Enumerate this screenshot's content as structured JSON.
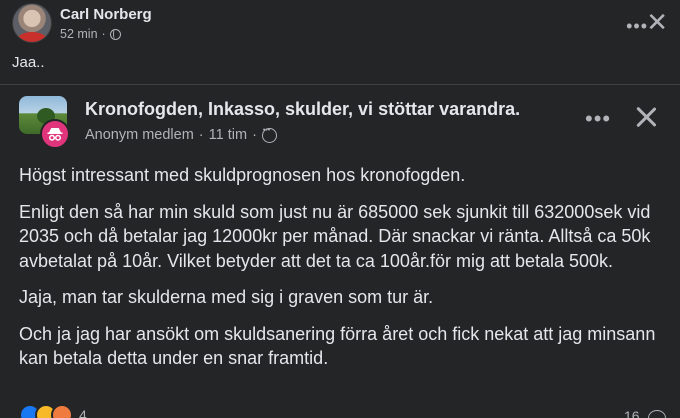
{
  "outer_post": {
    "author": "Carl Norberg",
    "time": "52 min",
    "privacy_icon": "globe-icon",
    "text": "Jaa.."
  },
  "shared_post": {
    "group_name": "Kronofogden, Inkasso, skulder, vi stöttar varandra.",
    "author": "Anonym medlem",
    "separator": "·",
    "time": "11 tim",
    "audience_icon": "group-icon",
    "paragraphs": [
      "Högst intressant med skuldprognosen hos kronofogden.",
      "Enligt den så har min skuld som just nu är 685000 sek sjunkit till 632000sek vid 2035 och då betalar jag 12000kr per månad. Där snackar vi ränta. Alltså ca 50k avbetalat på 10år. Vilket betyder att det ta ca 100år.för mig att betala 500k.",
      "Jaja, man tar skulderna med sig i graven som tur är.",
      "Och ja jag har ansökt om skuldsanering förra året och fick nekat att jag minsann kan betala detta under en snar framtid."
    ]
  },
  "footer": {
    "reaction_count": "4",
    "comment_count": "16"
  },
  "icons": {
    "more": "more-icon",
    "close": "close-icon",
    "anonymous": "anonymous-icon",
    "comment": "comment-icon"
  },
  "colors": {
    "background": "#242526",
    "text": "#e4e6eb",
    "secondary_text": "#b0b3b8",
    "anonymous_badge": "#e0357c",
    "like_blue": "#1877f2"
  }
}
